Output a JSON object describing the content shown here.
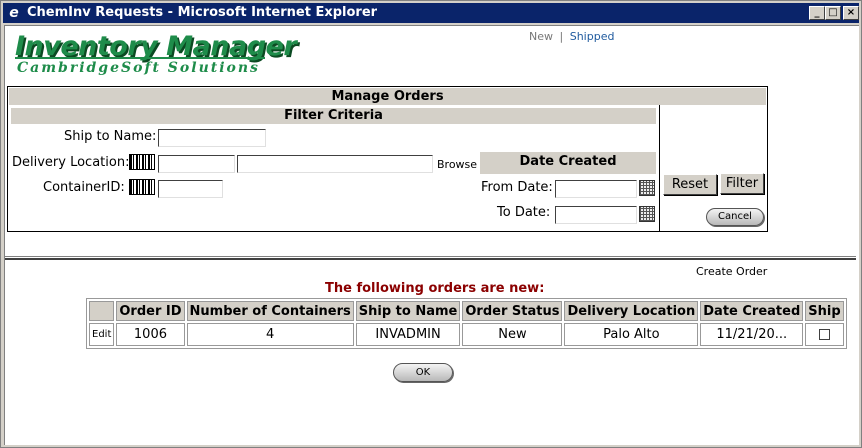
{
  "window": {
    "title": "ChemInv Requests - Microsoft Internet Explorer"
  },
  "logo": {
    "line1": "Inventory Manager",
    "line2": "CambridgeSoft Solutions"
  },
  "nav": {
    "new_label": "New",
    "separator": "|",
    "shipped_label": "Shipped"
  },
  "manage": {
    "title": "Manage Orders",
    "filter_title": "Filter Criteria",
    "ship_to_name_label": "Ship to Name:",
    "delivery_location_label": "Delivery Location:",
    "container_id_label": "ContainerID:",
    "browse_label": "Browse",
    "date_created_title": "Date Created",
    "from_date_label": "From Date:",
    "to_date_label": "To Date:",
    "ship_to_name_value": "",
    "delivery_location_id_value": "",
    "delivery_location_name_value": "",
    "container_id_value": "",
    "from_date_value": "",
    "to_date_value": "",
    "reset_label": "Reset",
    "filter_label": "Filter",
    "cancel_label": "Cancel"
  },
  "create_order_label": "Create Order",
  "orders_heading": "The following orders are new:",
  "table": {
    "headers": [
      "",
      "Order ID",
      "Number of Containers",
      "Ship to Name",
      "Order Status",
      "Delivery Location",
      "Date Created",
      "Ship"
    ],
    "rows": [
      {
        "edit": "Edit",
        "order_id": "1006",
        "containers": "4",
        "ship_to": "INVADMIN",
        "status": "New",
        "location": "Palo Alto",
        "date": "11/21/20...",
        "ship": false
      }
    ]
  },
  "ok_label": "OK",
  "colors": {
    "titlebar": "#0a246a",
    "logo_green": "#1e8c4a",
    "link_blue": "#1f5a9e",
    "heading_red": "#8b0000",
    "panel_gray": "#d4d0c8"
  }
}
